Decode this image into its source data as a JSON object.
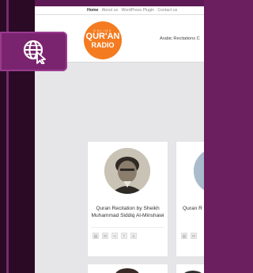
{
  "topbar": {
    "links": [
      "Home",
      "About us",
      "WordPress Plugin",
      "Contact us"
    ]
  },
  "logo": {
    "line1": "ONLINE",
    "line2": "QUR'AN",
    "line3": "RADIO"
  },
  "nav": {
    "item": "Arabic Recitations C"
  },
  "cards": [
    {
      "title": "Quran Recitation by Sheikh Muhammad Siddiq Al-Minshawi",
      "share_icons": [
        "print-icon",
        "email-icon",
        "share-icon",
        "facebook-icon",
        "user-icon"
      ]
    },
    {
      "title": "Quran R"
    }
  ],
  "badge": {
    "icon": "globe-cursor-icon",
    "color": "#7a2470"
  },
  "colors": {
    "frame": "#5e1a55",
    "logo_orange": "#f47b20"
  }
}
